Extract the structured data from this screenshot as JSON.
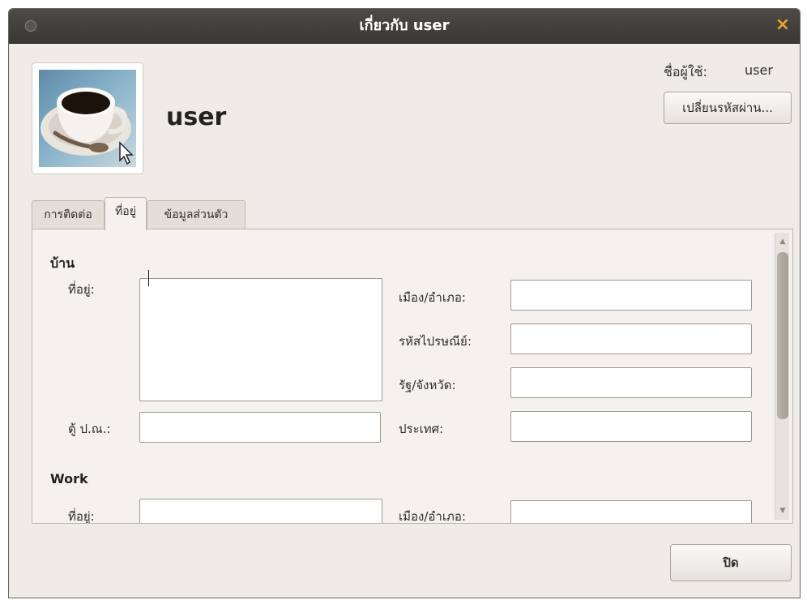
{
  "window": {
    "title": "เกี่ยวกับ user",
    "close_glyph": "×"
  },
  "profile": {
    "display_name": "user",
    "username_label": "ชื่อผู้ใช้:",
    "username_value": "user",
    "change_password_label": "เปลี่ยนรหัสผ่าน..."
  },
  "tabs": [
    {
      "label": "การติดต่อ",
      "active": false
    },
    {
      "label": "ที่อยู่",
      "active": true
    },
    {
      "label": "ข้อมูลส่วนตัว",
      "active": false
    }
  ],
  "home": {
    "section_title": "บ้าน",
    "address_label": "ที่อยู่:",
    "address_value": "",
    "po_box_label": "ตู้ ป.ณ.:",
    "po_box_value": "",
    "city_label": "เมือง/อำเภอ:",
    "city_value": "",
    "postcode_label": "รหัสไปรษณีย์:",
    "postcode_value": "",
    "state_label": "รัฐ/จังหวัด:",
    "state_value": "",
    "country_label": "ประเทศ:",
    "country_value": ""
  },
  "work": {
    "section_title": "Work",
    "address_label": "ที่อยู่:",
    "address_value": "",
    "city_label": "เมือง/อำเภอ:",
    "city_value": ""
  },
  "scrollbar": {
    "up_glyph": "▲",
    "down_glyph": "▼"
  },
  "footer": {
    "close_label": "ปิด"
  },
  "icons": {
    "window_menu": "circle-icon",
    "window_close": "close-icon",
    "avatar": "coffee-cup-avatar"
  },
  "colors": {
    "titlebar": "#3f3d39",
    "window_bg": "#efebe6",
    "close_accent": "#f0a030"
  }
}
